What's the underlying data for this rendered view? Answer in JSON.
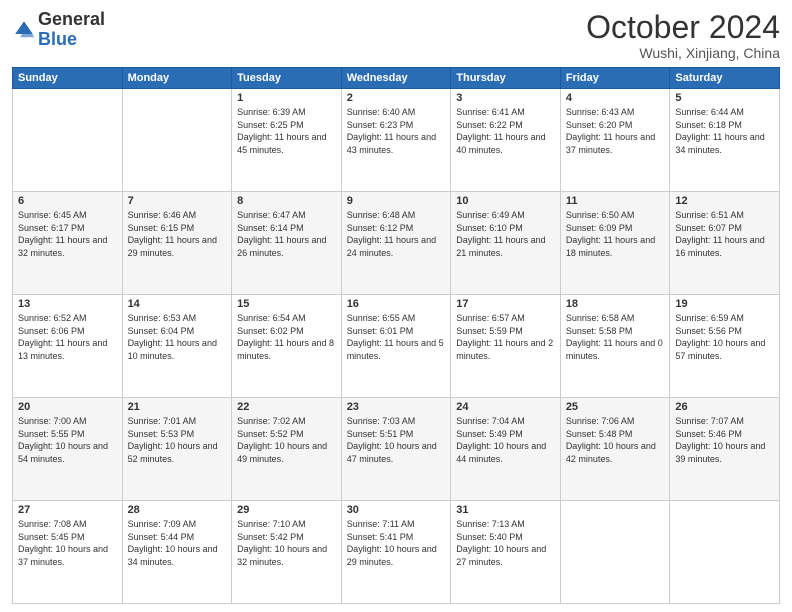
{
  "header": {
    "logo_general": "General",
    "logo_blue": "Blue",
    "month_title": "October 2024",
    "location": "Wushi, Xinjiang, China"
  },
  "days_of_week": [
    "Sunday",
    "Monday",
    "Tuesday",
    "Wednesday",
    "Thursday",
    "Friday",
    "Saturday"
  ],
  "weeks": [
    [
      {
        "day": "",
        "content": ""
      },
      {
        "day": "",
        "content": ""
      },
      {
        "day": "1",
        "content": "Sunrise: 6:39 AM\nSunset: 6:25 PM\nDaylight: 11 hours and 45 minutes."
      },
      {
        "day": "2",
        "content": "Sunrise: 6:40 AM\nSunset: 6:23 PM\nDaylight: 11 hours and 43 minutes."
      },
      {
        "day": "3",
        "content": "Sunrise: 6:41 AM\nSunset: 6:22 PM\nDaylight: 11 hours and 40 minutes."
      },
      {
        "day": "4",
        "content": "Sunrise: 6:43 AM\nSunset: 6:20 PM\nDaylight: 11 hours and 37 minutes."
      },
      {
        "day": "5",
        "content": "Sunrise: 6:44 AM\nSunset: 6:18 PM\nDaylight: 11 hours and 34 minutes."
      }
    ],
    [
      {
        "day": "6",
        "content": "Sunrise: 6:45 AM\nSunset: 6:17 PM\nDaylight: 11 hours and 32 minutes."
      },
      {
        "day": "7",
        "content": "Sunrise: 6:46 AM\nSunset: 6:15 PM\nDaylight: 11 hours and 29 minutes."
      },
      {
        "day": "8",
        "content": "Sunrise: 6:47 AM\nSunset: 6:14 PM\nDaylight: 11 hours and 26 minutes."
      },
      {
        "day": "9",
        "content": "Sunrise: 6:48 AM\nSunset: 6:12 PM\nDaylight: 11 hours and 24 minutes."
      },
      {
        "day": "10",
        "content": "Sunrise: 6:49 AM\nSunset: 6:10 PM\nDaylight: 11 hours and 21 minutes."
      },
      {
        "day": "11",
        "content": "Sunrise: 6:50 AM\nSunset: 6:09 PM\nDaylight: 11 hours and 18 minutes."
      },
      {
        "day": "12",
        "content": "Sunrise: 6:51 AM\nSunset: 6:07 PM\nDaylight: 11 hours and 16 minutes."
      }
    ],
    [
      {
        "day": "13",
        "content": "Sunrise: 6:52 AM\nSunset: 6:06 PM\nDaylight: 11 hours and 13 minutes."
      },
      {
        "day": "14",
        "content": "Sunrise: 6:53 AM\nSunset: 6:04 PM\nDaylight: 11 hours and 10 minutes."
      },
      {
        "day": "15",
        "content": "Sunrise: 6:54 AM\nSunset: 6:02 PM\nDaylight: 11 hours and 8 minutes."
      },
      {
        "day": "16",
        "content": "Sunrise: 6:55 AM\nSunset: 6:01 PM\nDaylight: 11 hours and 5 minutes."
      },
      {
        "day": "17",
        "content": "Sunrise: 6:57 AM\nSunset: 5:59 PM\nDaylight: 11 hours and 2 minutes."
      },
      {
        "day": "18",
        "content": "Sunrise: 6:58 AM\nSunset: 5:58 PM\nDaylight: 11 hours and 0 minutes."
      },
      {
        "day": "19",
        "content": "Sunrise: 6:59 AM\nSunset: 5:56 PM\nDaylight: 10 hours and 57 minutes."
      }
    ],
    [
      {
        "day": "20",
        "content": "Sunrise: 7:00 AM\nSunset: 5:55 PM\nDaylight: 10 hours and 54 minutes."
      },
      {
        "day": "21",
        "content": "Sunrise: 7:01 AM\nSunset: 5:53 PM\nDaylight: 10 hours and 52 minutes."
      },
      {
        "day": "22",
        "content": "Sunrise: 7:02 AM\nSunset: 5:52 PM\nDaylight: 10 hours and 49 minutes."
      },
      {
        "day": "23",
        "content": "Sunrise: 7:03 AM\nSunset: 5:51 PM\nDaylight: 10 hours and 47 minutes."
      },
      {
        "day": "24",
        "content": "Sunrise: 7:04 AM\nSunset: 5:49 PM\nDaylight: 10 hours and 44 minutes."
      },
      {
        "day": "25",
        "content": "Sunrise: 7:06 AM\nSunset: 5:48 PM\nDaylight: 10 hours and 42 minutes."
      },
      {
        "day": "26",
        "content": "Sunrise: 7:07 AM\nSunset: 5:46 PM\nDaylight: 10 hours and 39 minutes."
      }
    ],
    [
      {
        "day": "27",
        "content": "Sunrise: 7:08 AM\nSunset: 5:45 PM\nDaylight: 10 hours and 37 minutes."
      },
      {
        "day": "28",
        "content": "Sunrise: 7:09 AM\nSunset: 5:44 PM\nDaylight: 10 hours and 34 minutes."
      },
      {
        "day": "29",
        "content": "Sunrise: 7:10 AM\nSunset: 5:42 PM\nDaylight: 10 hours and 32 minutes."
      },
      {
        "day": "30",
        "content": "Sunrise: 7:11 AM\nSunset: 5:41 PM\nDaylight: 10 hours and 29 minutes."
      },
      {
        "day": "31",
        "content": "Sunrise: 7:13 AM\nSunset: 5:40 PM\nDaylight: 10 hours and 27 minutes."
      },
      {
        "day": "",
        "content": ""
      },
      {
        "day": "",
        "content": ""
      }
    ]
  ]
}
